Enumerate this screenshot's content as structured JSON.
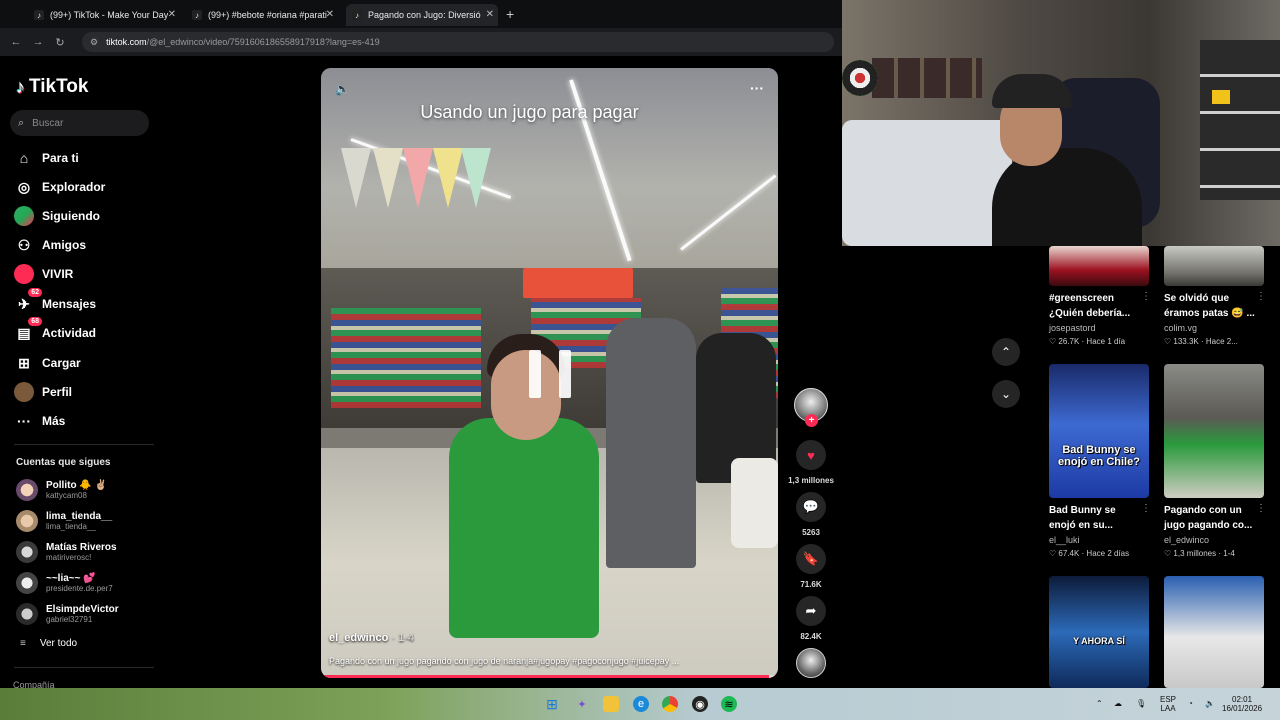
{
  "browser": {
    "tabs": [
      {
        "title": "(99+) TikTok - Make Your Day"
      },
      {
        "title": "(99+) #bebote #oriana #parati"
      },
      {
        "title": "Pagando con Jugo: Diversió"
      }
    ],
    "url_host": "tiktok.com",
    "url_path": "/@el_edwinco/video/7591606186558917918?lang=es-419"
  },
  "sidebar": {
    "logo": "TikTok",
    "search_placeholder": "Buscar",
    "nav": [
      {
        "label": "Para ti",
        "icon": "home-icon"
      },
      {
        "label": "Explorador",
        "icon": "compass-icon"
      },
      {
        "label": "Siguiendo",
        "icon": "following-avatar-icon"
      },
      {
        "label": "Amigos",
        "icon": "friends-icon"
      },
      {
        "label": "VIVIR",
        "icon": "live-icon"
      },
      {
        "label": "Mensajes",
        "icon": "messages-icon",
        "badge": "62"
      },
      {
        "label": "Actividad",
        "icon": "activity-icon",
        "badge": "68"
      },
      {
        "label": "Cargar",
        "icon": "upload-icon"
      },
      {
        "label": "Perfil",
        "icon": "profile-avatar-icon"
      },
      {
        "label": "Más",
        "icon": "more-dots-icon"
      }
    ],
    "following_title": "Cuentas que sigues",
    "following": [
      {
        "name": "Pollito 🐥 ✌🏼",
        "handle": "kattycam08"
      },
      {
        "name": "lima_tienda__",
        "handle": "lima_tienda__"
      },
      {
        "name": "Matías Riveros",
        "handle": "matiriverosc!"
      },
      {
        "name": "~~lia~~ 💕",
        "handle": "presidente.de.per7"
      },
      {
        "name": "ElsimpdeVictor",
        "handle": "gabriel32791"
      }
    ],
    "see_all": "Ver todo",
    "company": "Compañía"
  },
  "video": {
    "overlay_title": "Usando un jugo para pagar",
    "author": "el_edwinco",
    "date": "· 1-4",
    "caption": "Pagando con un jugo pagando con jugo de naranja#jugopay #pagoconjugo #juicepay ...",
    "progress": 0.98,
    "actions": {
      "likes": "1,3 millones",
      "comments": "5263",
      "saves": "71.6K",
      "shares": "82.4K"
    }
  },
  "recommendations": [
    {
      "title_lines": [
        "#greenscreen",
        "¿Quién debería..."
      ],
      "author": "josepastord",
      "likes": "26.7K",
      "when": "Hace 1 día",
      "thumb_text": ""
    },
    {
      "title_lines": [
        "Se olvidó que",
        "éramos patas 😅 ..."
      ],
      "author": "colim.vg",
      "likes": "133.3K",
      "when": "Hace 2...",
      "thumb_text": ""
    },
    {
      "title_lines": [
        "Bad Bunny se",
        "enojó en su..."
      ],
      "author": "el__luki",
      "likes": "67.4K",
      "when": "Hace 2 días",
      "thumb_text": "Bad Bunny se enojó en Chile?"
    },
    {
      "title_lines": [
        "Pagando con un",
        "jugo pagando co..."
      ],
      "author": "el_edwinco",
      "likes": "1,3 millones",
      "when": "1-4",
      "thumb_text": ""
    },
    {
      "title_lines": [
        "",
        ""
      ],
      "author": "",
      "likes": "",
      "when": "",
      "thumb_text": "Y AHORA SÍ"
    },
    {
      "title_lines": [
        "",
        ""
      ],
      "author": "",
      "likes": "",
      "when": "",
      "thumb_text": ""
    }
  ],
  "taskbar": {
    "lang_top": "ESP",
    "lang_bottom": "LAA",
    "time": "02:01",
    "date": "16/01/2026"
  },
  "colors": {
    "accent": "#fe2c55",
    "bg": "#000000"
  }
}
